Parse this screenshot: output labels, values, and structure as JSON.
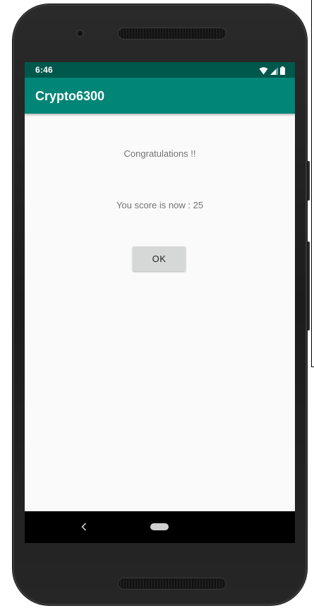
{
  "status_bar": {
    "time": "6:46",
    "icons": [
      "wifi-icon",
      "cell-signal-icon",
      "battery-icon"
    ],
    "color": "#00574b"
  },
  "app_bar": {
    "title": "Crypto6300",
    "color": "#008577"
  },
  "content": {
    "message": "Congratulations !!",
    "score_text": "You score is now : 25",
    "ok_label": "OK"
  },
  "nav_bar": {
    "icons": [
      "back-icon",
      "home-icon"
    ]
  }
}
